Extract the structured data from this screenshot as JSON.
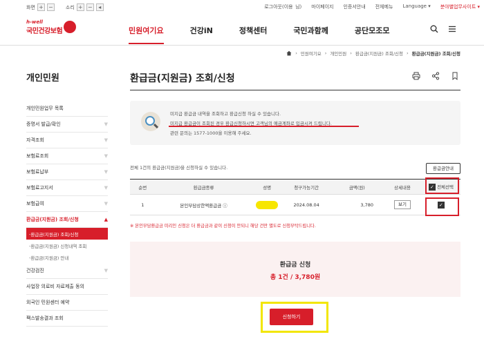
{
  "util": {
    "zoom_label": "화면",
    "sound_label": "소리",
    "links": [
      "로그아웃(이용 님)",
      "마이페이지",
      "인증서안내",
      "전체메뉴",
      "Language ▾",
      "분야별업무사이트 ▾"
    ]
  },
  "logo": {
    "tagline": "h-well",
    "name": "국민건강보험"
  },
  "gnb": [
    "민원여기요",
    "건강iN",
    "정책센터",
    "국민과함께",
    "공단모조모"
  ],
  "breadcrumb": [
    "민원여기요",
    "개인민원",
    "환급금(지원금) 조회/신청",
    "환급금(지원금) 조회/신청"
  ],
  "sidebar": {
    "title": "개인민원",
    "items": [
      {
        "label": "개인민원업무 목록",
        "chev": false
      },
      {
        "label": "증명서 발급/확인",
        "chev": true
      },
      {
        "label": "자격조회",
        "chev": true
      },
      {
        "label": "보험료조회",
        "chev": true
      },
      {
        "label": "보험료납부",
        "chev": true
      },
      {
        "label": "보험료고지서",
        "chev": true
      },
      {
        "label": "보험급여",
        "chev": true
      }
    ],
    "active": "환급금(지원금) 조회/신청",
    "subitems": [
      "환급금(지원금) 조회/신청",
      "환급금(지원금) 신청내역 조회",
      "환급금(지원금) 안내"
    ],
    "items_after": [
      "건강검진",
      "사업장 의료비 자료제출 동의",
      "외국인 민원센터 예약",
      "팩스발송결과 조회"
    ]
  },
  "page": {
    "title": "환급금(지원금) 조회/신청",
    "notice": [
      "미지급 환급금 내역을 조회하고 환급신청 하실 수 있습니다.",
      "미지급 환급금이 조회된 경우 환급신청하시면 고객님의 예금계좌로 입금시켜 드립니다.",
      "관련 문의는 1577-1000을 이용해 주세요."
    ],
    "count_text": "전체 1건의 환급금(지원금)을 신청하실 수 있습니다.",
    "guide_button": "환급금안내",
    "table": {
      "headers": [
        "순번",
        "환급금종류",
        "성명",
        "청구가능기간",
        "금액(원)",
        "상세내용",
        "전체선택"
      ],
      "rows": [
        {
          "no": "1",
          "type": "본인부담상한액환급금 ⓘ",
          "period": "2024.08.04",
          "amount": "3,780",
          "detail": "보기"
        }
      ]
    },
    "warning": "※ 본인부담환급금 미리인 신청은 더 환급금과 같이 신청이 안되니 해당 건만 별도로 신청부탁드립니다.",
    "summary_title": "환급금 신청",
    "summary_value": "총 1건 / 3,780원",
    "apply_button": "신청하기"
  },
  "colors": {
    "brand": "#d71e2a",
    "highlight": "#f2e600"
  }
}
